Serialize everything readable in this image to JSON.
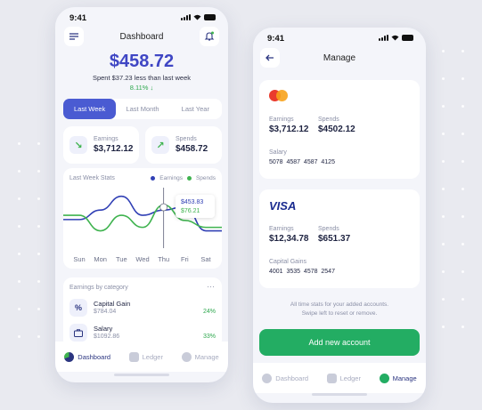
{
  "colors": {
    "accent": "#4a5bd2",
    "earnings": "#3140b5",
    "spends": "#3fb34f",
    "green": "#23ad63",
    "positive": "#2fa84f"
  },
  "dashboard": {
    "status_time": "9:41",
    "title": "Dashboard",
    "balance": "$458.72",
    "spent_note": "Spent $37.23 less than last week",
    "change_pct": "8.11%",
    "tabs": [
      "Last Week",
      "Last Month",
      "Last Year"
    ],
    "active_tab": "Last Week",
    "earnings_label": "Earnings",
    "earnings_value": "$3,712.12",
    "spends_label": "Spends",
    "spends_value": "$458.72",
    "chart": {
      "title": "Last Week Stats",
      "legend": [
        "Earnings",
        "Spends"
      ],
      "tooltip_earnings": "$453.83",
      "tooltip_spends": "$76.21",
      "highlight_day": "Thu"
    },
    "category": {
      "title": "Earnings by category",
      "more": "···",
      "items": [
        {
          "name": "Capital Gain",
          "amount": "$784.04",
          "pct": "24%",
          "icon": "percent-icon"
        },
        {
          "name": "Salary",
          "amount": "$1092.86",
          "pct": "33%",
          "icon": "briefcase-icon"
        }
      ]
    },
    "nav": [
      "Dashboard",
      "Ledger",
      "Manage"
    ]
  },
  "chart_data": {
    "type": "line",
    "title": "Last Week Stats",
    "categories": [
      "Sun",
      "Mon",
      "Tue",
      "Wed",
      "Thu",
      "Fri",
      "Sat"
    ],
    "series": [
      {
        "name": "Earnings",
        "values": [
          31,
          42,
          58,
          36,
          42,
          46,
          18
        ]
      },
      {
        "name": "Spends",
        "values": [
          36,
          18,
          36,
          22,
          48,
          30,
          22
        ]
      }
    ],
    "ylim": [
      0,
      70
    ],
    "grid": false,
    "legend_position": "top-right",
    "annotations": [
      "$453.83",
      "$76.21"
    ]
  },
  "manage": {
    "status_time": "9:41",
    "title": "Manage",
    "cards": [
      {
        "brand": "mastercard",
        "earnings_label": "Earnings",
        "earnings": "$3,712.12",
        "spends_label": "Spends",
        "spends": "$4502.12",
        "type_label": "Salary",
        "number": "5078  4587  4587  4125"
      },
      {
        "brand": "VISA",
        "earnings_label": "Earnings",
        "earnings": "$12,34.78",
        "spends_label": "Spends",
        "spends": "$651.37",
        "type_label": "Capital Gains",
        "number": "4001  3535  4578  2547"
      }
    ],
    "note_line1": "All time stats for your added accounts.",
    "note_line2": "Swipe left to reset or remove.",
    "add_button": "Add new account",
    "nav": [
      "Dashboard",
      "Ledger",
      "Manage"
    ]
  }
}
